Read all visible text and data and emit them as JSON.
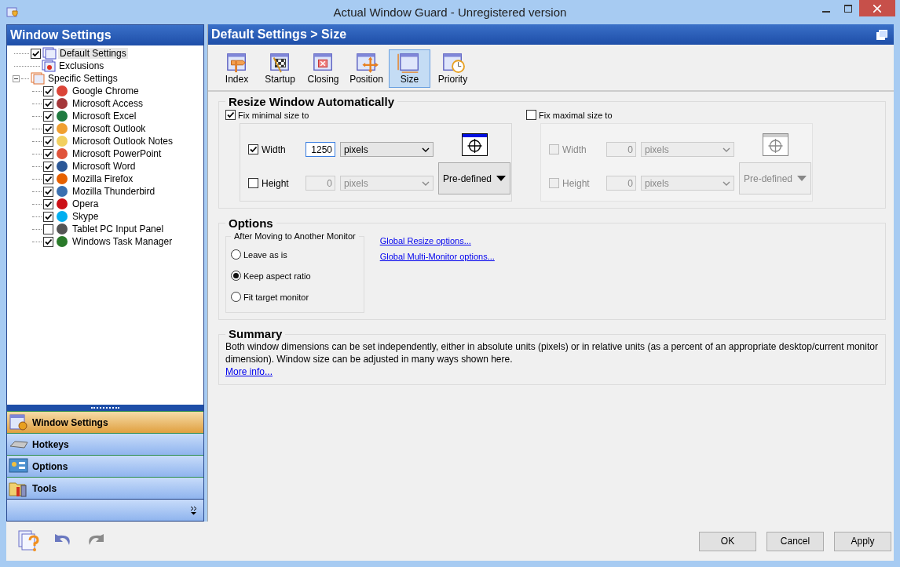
{
  "window": {
    "title": "Actual Window Guard - Unregistered version"
  },
  "sidebar": {
    "title": "Window Settings",
    "tree": [
      {
        "label": "Default Settings",
        "kind": "checkbox",
        "checked": true,
        "selected": true
      },
      {
        "label": "Exclusions",
        "kind": "plain",
        "selected": false
      },
      {
        "label": "Specific Settings",
        "kind": "plain",
        "selected": false,
        "expanded": true,
        "children": [
          {
            "label": "Google Chrome",
            "checked": true,
            "color": "#db4437"
          },
          {
            "label": "Microsoft Access",
            "checked": true,
            "color": "#a4373a"
          },
          {
            "label": "Microsoft Excel",
            "checked": true,
            "color": "#1f7a3f"
          },
          {
            "label": "Microsoft Outlook",
            "checked": true,
            "color": "#f0a030"
          },
          {
            "label": "Microsoft Outlook Notes",
            "checked": true,
            "color": "#f2d060"
          },
          {
            "label": "Microsoft PowerPoint",
            "checked": true,
            "color": "#e0533a"
          },
          {
            "label": "Microsoft Word",
            "checked": true,
            "color": "#2b5797"
          },
          {
            "label": "Mozilla Firefox",
            "checked": true,
            "color": "#e66000"
          },
          {
            "label": "Mozilla Thunderbird",
            "checked": true,
            "color": "#3a6fb0"
          },
          {
            "label": "Opera",
            "checked": true,
            "color": "#cc0f16"
          },
          {
            "label": "Skype",
            "checked": true,
            "color": "#00aff0"
          },
          {
            "label": "Tablet PC Input Panel",
            "checked": false,
            "color": "#555555"
          },
          {
            "label": "Windows Task Manager",
            "checked": true,
            "color": "#2a7a2a"
          }
        ]
      }
    ],
    "nav": [
      {
        "label": "Window Settings",
        "selected": true
      },
      {
        "label": "Hotkeys",
        "selected": false
      },
      {
        "label": "Options",
        "selected": false
      },
      {
        "label": "Tools",
        "selected": false
      }
    ]
  },
  "panel": {
    "title": "Default Settings > Size",
    "tabs": [
      {
        "label": "Index",
        "selected": false
      },
      {
        "label": "Startup",
        "selected": false
      },
      {
        "label": "Closing",
        "selected": false
      },
      {
        "label": "Position",
        "selected": false
      },
      {
        "label": "Size",
        "selected": true
      },
      {
        "label": "Priority",
        "selected": false
      }
    ],
    "resize": {
      "title": "Resize Window Automatically",
      "groups": [
        {
          "label": "Fix minimal size to",
          "checked": true,
          "disabled": false,
          "button": "Pre-defined",
          "rows": [
            {
              "label": "Width",
              "checked": true,
              "value": "1250",
              "unit": "pixels"
            },
            {
              "label": "Height",
              "checked": false,
              "value": "0",
              "unit": "pixels"
            }
          ]
        },
        {
          "label": "Fix maximal size to",
          "checked": false,
          "disabled": true,
          "button": "Pre-defined",
          "rows": [
            {
              "label": "Width",
              "checked": false,
              "value": "0",
              "unit": "pixels"
            },
            {
              "label": "Height",
              "checked": false,
              "value": "0",
              "unit": "pixels"
            }
          ]
        }
      ]
    },
    "options": {
      "title": "Options",
      "group_title": "After Moving to Another Monitor",
      "radios": [
        {
          "label": "Leave as is",
          "selected": false
        },
        {
          "label": "Keep aspect ratio",
          "selected": true
        },
        {
          "label": "Fit target monitor",
          "selected": false
        }
      ],
      "links": [
        "Global Resize options...",
        "Global Multi-Monitor options..."
      ]
    },
    "summary": {
      "title": "Summary",
      "text": "Both window dimensions can be set independently, either in absolute units (pixels) or in relative units (as a percent of an appropriate desktop/current monitor dimension). Window size can be adjusted in many ways shown here.",
      "link": "More info..."
    }
  },
  "buttons": [
    "OK",
    "Cancel",
    "Apply"
  ]
}
